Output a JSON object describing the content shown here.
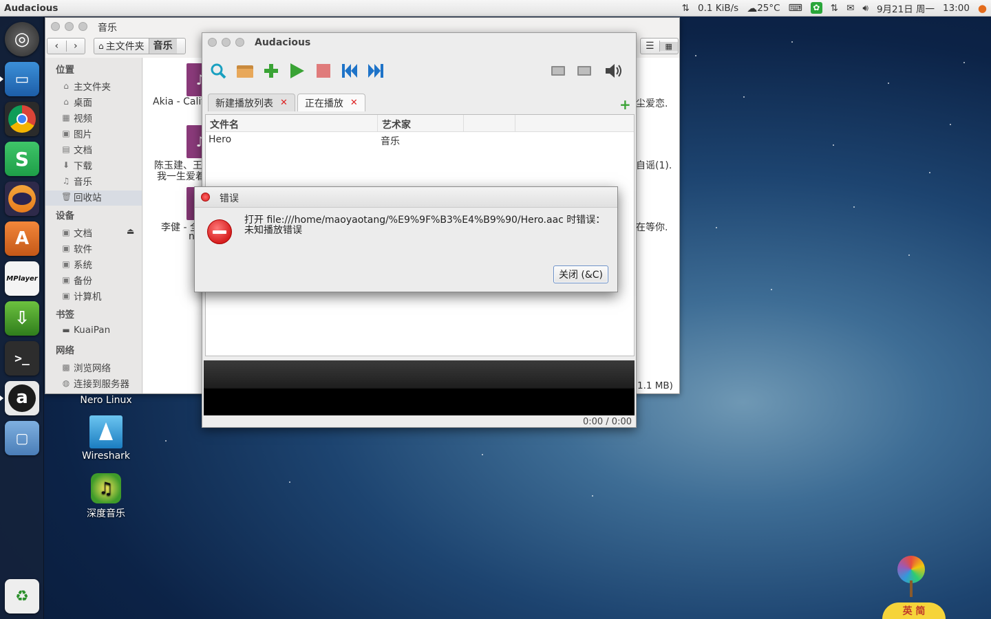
{
  "top_panel": {
    "app_title": "Audacious",
    "net_speed": "0.1 KiB/s",
    "weather": "25°C",
    "date": "9月21日 周一",
    "time": "13:00"
  },
  "file_manager": {
    "title": "音乐",
    "breadcrumb_home": "主文件夹",
    "breadcrumb_current": "音乐",
    "sections": {
      "places": "位置",
      "devices": "设备",
      "bookmarks": "书签",
      "network": "网络"
    },
    "places": [
      "主文件夹",
      "桌面",
      "视频",
      "图片",
      "文档",
      "下载",
      "音乐",
      "回收站"
    ],
    "devices": [
      "文档",
      "软件",
      "系统",
      "备份",
      "计算机"
    ],
    "bookmarks": [
      "KuaiPan"
    ],
    "network": [
      "浏览网络",
      "连接到服务器"
    ],
    "content": {
      "item1": "Akia - Calif",
      "item2_line1": "陈玉建、王",
      "item2_line2": "我一生爱着",
      "item3": "李健 - 全",
      "item3_line2": "n",
      "right1": "尘爱恋.",
      "right2": "自谣(1).",
      "right3": "在等你.",
      "status": "1.1 MB)"
    }
  },
  "audacious": {
    "title": "Audacious",
    "tabs": [
      {
        "label": "新建播放列表"
      },
      {
        "label": "正在播放"
      }
    ],
    "columns": [
      "文件名",
      "艺术家"
    ],
    "rows": [
      {
        "filename": "Hero",
        "artist": "音乐"
      }
    ],
    "time": "0:00 / 0:00"
  },
  "error_dialog": {
    "title": "错误",
    "message": "打开 file:///home/maoyaotang/%E9%9F%B3%E4%B9%90/Hero.aac 时错误：未知播放错误",
    "close_button": "关闭 (&C)"
  },
  "desktop_icons": {
    "nero": "Nero Linux",
    "wireshark": "Wireshark",
    "deepin_music": "深度音乐"
  },
  "ime": "英 简",
  "colors": {
    "error_red": "#d61f1f",
    "play_green": "#2e9a1e",
    "accent_blue": "#1e73c8"
  }
}
